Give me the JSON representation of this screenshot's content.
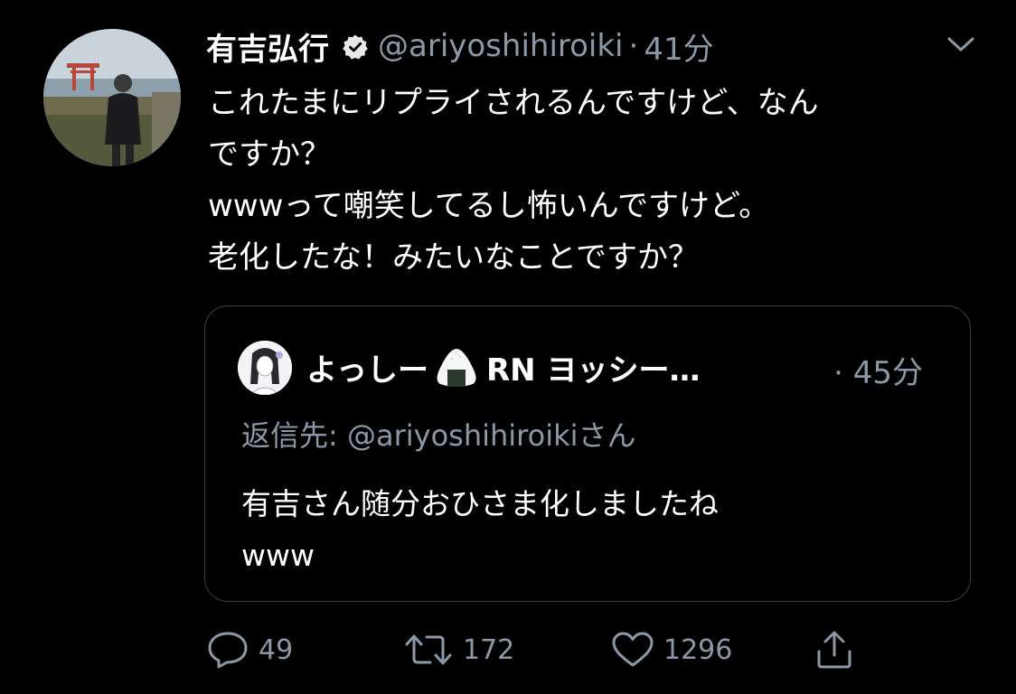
{
  "tweet": {
    "author_name": "有吉弘行",
    "handle": "@ariyoshihiroiki",
    "separator": "·",
    "time": "41分",
    "verified_icon": "verified-badge-icon",
    "text_lines": [
      "これたまにリプライされるんですけど、なん",
      "ですか？",
      "wwwって嘲笑してるし怖いんですけど。",
      "老化したな！みたいなことですか？"
    ]
  },
  "quoted_tweet": {
    "author_name": "よっしー",
    "author_emoji_icon": "onigiri-icon",
    "author_name_suffix": "RN ヨッシー…",
    "separator": "·",
    "time": "45分",
    "reply_label": "返信先: ",
    "reply_handle": "@ariyoshihiroiki",
    "reply_suffix": "さん",
    "text_lines": [
      "有吉さん随分おひさま化しましたね",
      "www"
    ]
  },
  "actions": {
    "reply_count": "49",
    "retweet_count": "172",
    "like_count": "1296"
  },
  "colors": {
    "background": "#000000",
    "primary_text": "#ffffff",
    "secondary_text": "#8b98a5",
    "border": "#3a3f45"
  }
}
